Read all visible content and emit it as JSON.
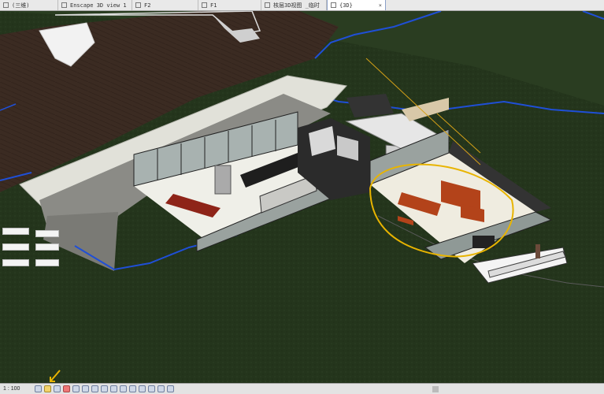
{
  "tabs": [
    {
      "label": "(三维)",
      "active": false,
      "icon": "3d-view-icon"
    },
    {
      "label": "Enscape 3D view 1",
      "active": false,
      "icon": "3d-view-icon"
    },
    {
      "label": "F2",
      "active": false,
      "icon": "floor-plan-icon"
    },
    {
      "label": "F1",
      "active": false,
      "icon": "floor-plan-icon"
    },
    {
      "label": "核层3D视图 _临时",
      "active": false,
      "icon": "3d-view-icon"
    },
    {
      "label": "{3D}",
      "active": true,
      "icon": "3d-view-icon",
      "close": "×"
    }
  ],
  "status": {
    "scale": "1 : 100"
  },
  "colors": {
    "terrain": "#22331a",
    "deck": "#3a2a22",
    "wall": "#d8d8d0",
    "floor": "#efefe8",
    "annotation": "#e8b400",
    "boundary": "#1f4fd6"
  }
}
